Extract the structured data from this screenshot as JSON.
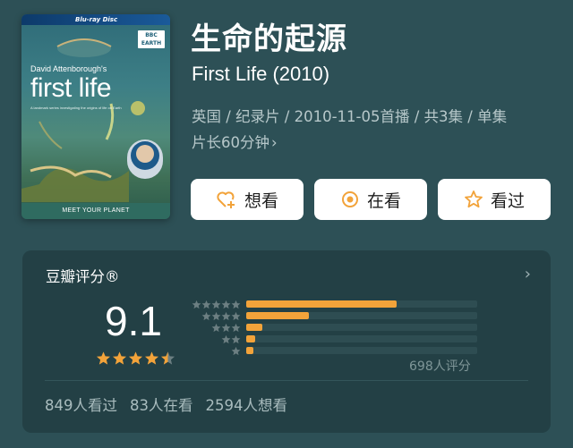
{
  "poster": {
    "bluray_label": "Blu-ray Disc",
    "badge_line1": "BBC",
    "badge_line2": "EARTH",
    "author": "David Attenborough's",
    "title": "first life",
    "tagline": "A landmark series investigating the origins of life on Earth",
    "footer": "MEET YOUR PLANET"
  },
  "title": "生命的起源",
  "subtitle": "First Life (2010)",
  "meta_line1": "英国 / 纪录片 / 2010-11-05首播 / 共3集 / 单集",
  "meta_line2": "片长60分钟",
  "meta_chevron": "›",
  "buttons": {
    "want": "想看",
    "watching": "在看",
    "watched": "看过"
  },
  "rating": {
    "label": "豆瓣评分®",
    "arrow": "›",
    "score": "9.1",
    "score_stars": 4.5,
    "distribution": [
      0.65,
      0.27,
      0.07,
      0.04,
      0.03
    ],
    "count_label": "698人评分",
    "colors": {
      "accent": "#f2a33a",
      "star_off": "#6c7f82",
      "track": "#2e4d52"
    }
  },
  "stats": {
    "watched": "849人看过",
    "watching": "83人在看",
    "want": "2594人想看"
  }
}
